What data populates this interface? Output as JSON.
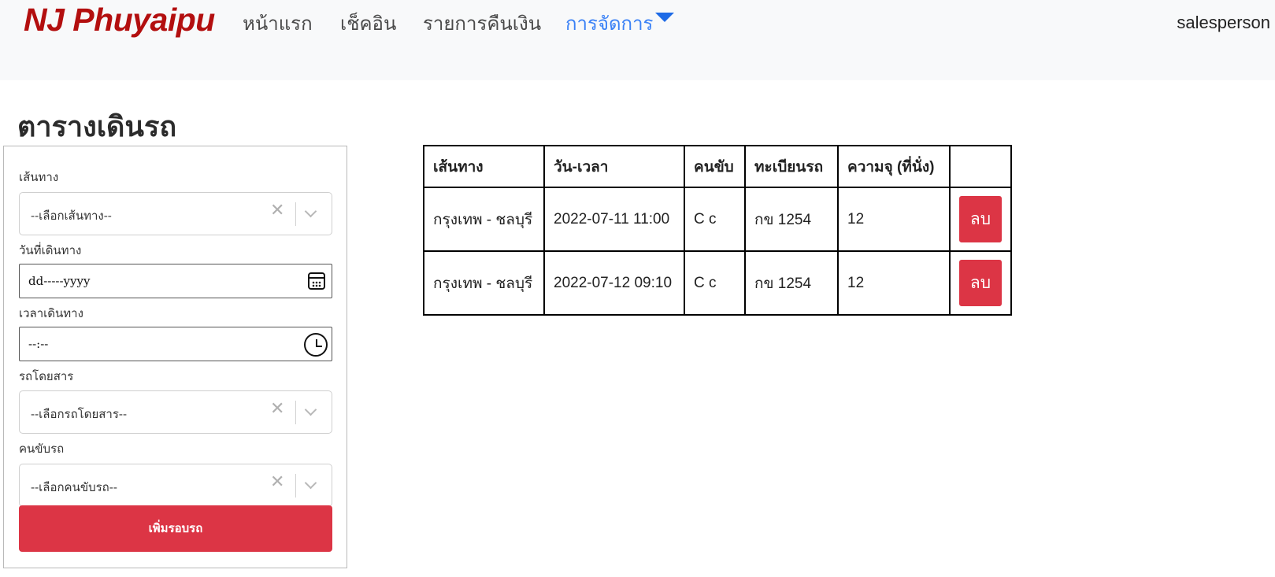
{
  "navbar": {
    "brand": "NJ Phuyaipu",
    "links": [
      "หน้าแรก",
      "เช็คอิน",
      "รายการคืนเงิน",
      "การจัดการ"
    ],
    "user": "salesperson"
  },
  "page": {
    "title": "ตารางเดินรถ"
  },
  "form": {
    "route_label": "เส้นทาง",
    "route_placeholder": "--เลือกเส้นทาง--",
    "date_label": "วันที่เดินทาง",
    "date_placeholder": "dd-----yyyy",
    "time_label": "เวลาเดินทาง",
    "time_placeholder": "--:--",
    "bus_label": "รถโดยสาร",
    "bus_placeholder": "--เลือกรถโดยสาร--",
    "driver_label": "คนขับรถ",
    "driver_placeholder": "--เลือกคนขับรถ--",
    "submit_label": "เพิ่มรอบรถ"
  },
  "table": {
    "headers": [
      "เส้นทาง",
      "วัน-เวลา",
      "คนขับ",
      "ทะเบียนรถ",
      "ความจุ (ที่นั่ง)",
      ""
    ],
    "rows": [
      {
        "route": "กรุงเทพ - ชลบุรี",
        "datetime": "2022-07-11 11:00",
        "driver": "C c",
        "plate": "กข 1254",
        "capacity": "12",
        "action": "ลบ"
      },
      {
        "route": "กรุงเทพ - ชลบุรี",
        "datetime": "2022-07-12 09:10",
        "driver": "C c",
        "plate": "กข 1254",
        "capacity": "12",
        "action": "ลบ"
      }
    ]
  },
  "colors": {
    "brand": "#b30f0f",
    "active_link": "#3b82f6",
    "danger": "#dc3545",
    "navbar_bg": "#f8f9fa"
  },
  "icons": {
    "calendar": "calendar-icon",
    "clock": "clock-icon",
    "caret": "caret-down-icon",
    "clear": "clear-icon",
    "chevron": "chevron-down-icon"
  }
}
